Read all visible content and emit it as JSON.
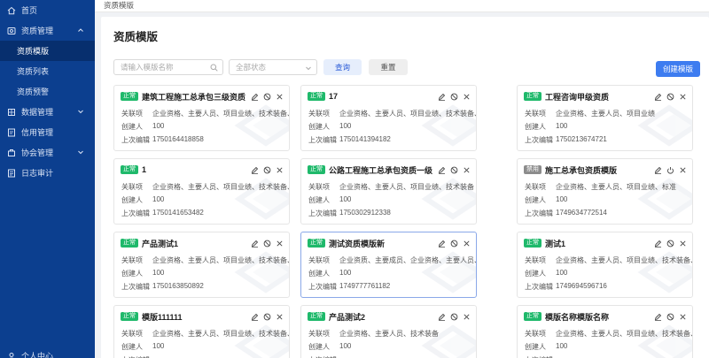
{
  "sidebar": {
    "items": [
      {
        "label": "首页",
        "icon": "home-icon"
      },
      {
        "label": "资质管理",
        "icon": "certificate-icon",
        "expanded": true,
        "children": [
          {
            "label": "资质模版",
            "active": true
          },
          {
            "label": "资质列表"
          },
          {
            "label": "资质预警"
          }
        ]
      },
      {
        "label": "数据管理",
        "icon": "database-icon",
        "expanded": false
      },
      {
        "label": "信用管理",
        "icon": "credit-icon",
        "expanded": false
      },
      {
        "label": "协会管理",
        "icon": "association-icon",
        "expanded": false
      },
      {
        "label": "日志审计",
        "icon": "log-icon"
      }
    ],
    "bottom": {
      "label": "个人中心",
      "icon": "user-icon"
    }
  },
  "breadcrumb": "资质模版",
  "page": {
    "title": "资质模版",
    "search_placeholder": "请输入模版名称",
    "status_placeholder": "全部状态",
    "query_label": "查询",
    "reset_label": "重置",
    "create_label": "创建模版"
  },
  "labels": {
    "related": "关联项",
    "creator": "创建人",
    "last_edit": "上次编辑"
  },
  "cards": [
    {
      "status": "正常",
      "title": "建筑工程施工总承包三级资质",
      "related": "企业资格、主要人员、项目业绩、技术装备、标准",
      "creator": "100",
      "edited": "1750164418858"
    },
    {
      "status": "正常",
      "title": "17",
      "related": "企业资格、主要人员、项目业绩、技术装备、标准",
      "creator": "100",
      "edited": "1750141394182"
    },
    {
      "status": "正常",
      "title": "工程咨询甲级资质",
      "related": "企业资格、主要人员、项目业绩",
      "creator": "100",
      "edited": "1750213674721"
    },
    {
      "status": "正常",
      "title": "1",
      "related": "企业资格、主要人员、项目业绩、技术装备、标准",
      "creator": "100",
      "edited": "1750141653482"
    },
    {
      "status": "正常",
      "title": "公路工程施工总承包资质一级",
      "related": "企业资格、主要人员、项目业绩、技术装备",
      "creator": "100",
      "edited": "1750302912338"
    },
    {
      "status": "禁用",
      "title": "施工总承包资质模版",
      "related": "企业资格、主要人员、项目业绩、标准",
      "creator": "100",
      "edited": "1749634772514"
    },
    {
      "status": "正常",
      "title": "产品测试1",
      "related": "企业资格、主要人员、项目业绩、技术装备、标准",
      "creator": "100",
      "edited": "1750163850892"
    },
    {
      "status": "正常",
      "title": "测试资质模版新",
      "related": "企业资质、主要成员、企业资格、主要人员、项目业绩、技术装备",
      "creator": "100",
      "edited": "1749777761182",
      "highlight": true
    },
    {
      "status": "正常",
      "title": "测试1",
      "related": "企业资格、主要人员、项目业绩、技术装备、标准",
      "creator": "100",
      "edited": "1749694596716"
    },
    {
      "status": "正常",
      "title": "模版111111",
      "related": "企业资格、主要人员、项目业绩、技术装备、标准",
      "creator": "100",
      "edited": ""
    },
    {
      "status": "正常",
      "title": "产品测试2",
      "related": "企业资格、主要人员、技术装备",
      "creator": "100",
      "edited": ""
    },
    {
      "status": "正常",
      "title": "模版名称模版名称",
      "related": "企业资格、主要人员、项目业绩、技术装备、标准",
      "creator": "100",
      "edited": ""
    }
  ],
  "colors": {
    "sidebar": "#0c3f8f",
    "accent": "#3d7cf0",
    "badge_on": "#1fb96b",
    "badge_off": "#8c8c8c"
  }
}
